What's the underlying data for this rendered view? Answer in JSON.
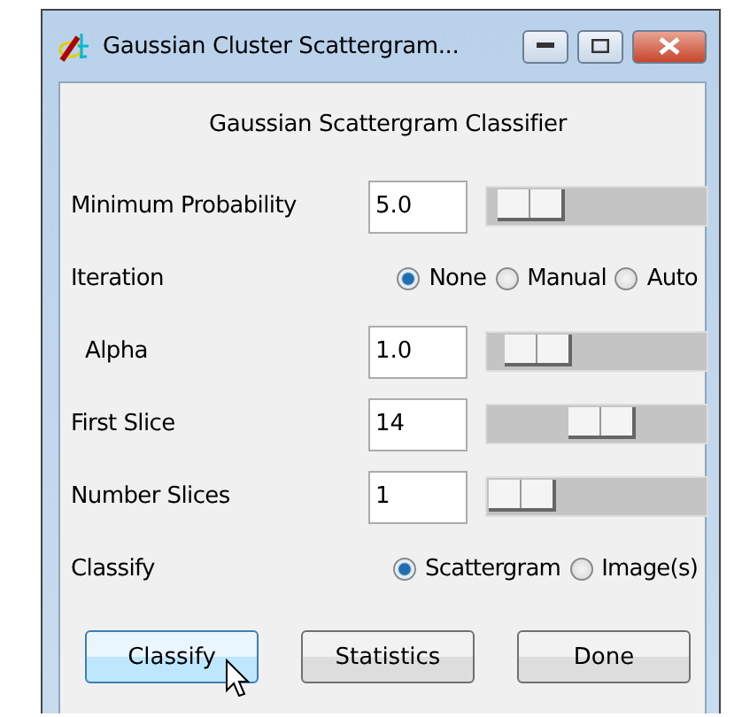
{
  "window": {
    "title": "Gaussian Cluster Scattergram..."
  },
  "heading": "Gaussian Scattergram Classifier",
  "rows": [
    {
      "kind": "slider",
      "label": "Minimum Probability",
      "indent": false,
      "value": "5.0",
      "level": 0.06
    },
    {
      "kind": "radio",
      "label": "Iteration",
      "options": [
        {
          "label": "None",
          "selected": true
        },
        {
          "label": "Manual",
          "selected": false
        },
        {
          "label": "Auto",
          "selected": false
        }
      ]
    },
    {
      "kind": "slider",
      "label": "Alpha",
      "indent": true,
      "value": "1.0",
      "level": 0.1
    },
    {
      "kind": "slider",
      "label": "First Slice",
      "indent": false,
      "value": "14",
      "level": 0.5
    },
    {
      "kind": "slider",
      "label": "Number Slices",
      "indent": false,
      "value": "1",
      "level": 0.0
    },
    {
      "kind": "radio",
      "label": "Classify",
      "options": [
        {
          "label": "Scattergram",
          "selected": true
        },
        {
          "label": "Image(s)",
          "selected": false
        }
      ]
    }
  ],
  "buttons": [
    {
      "label": "Classify",
      "hovered": true
    },
    {
      "label": "Statistics",
      "hovered": false
    },
    {
      "label": "Done",
      "hovered": false
    }
  ]
}
